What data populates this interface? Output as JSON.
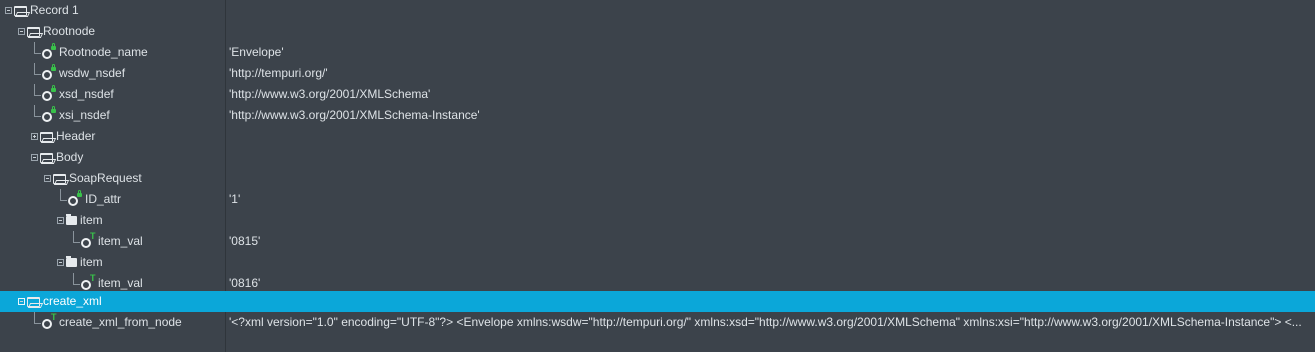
{
  "rows": [
    {
      "label": "Record 1",
      "value": ""
    },
    {
      "label": "Rootnode",
      "value": ""
    },
    {
      "label": "Rootnode_name",
      "value": "'Envelope'"
    },
    {
      "label": "wsdw_nsdef",
      "value": "'http://tempuri.org/'"
    },
    {
      "label": "xsd_nsdef",
      "value": "'http://www.w3.org/2001/XMLSchema'"
    },
    {
      "label": "xsi_nsdef",
      "value": "'http://www.w3.org/2001/XMLSchema-Instance'"
    },
    {
      "label": "Header",
      "value": ""
    },
    {
      "label": "Body",
      "value": ""
    },
    {
      "label": "SoapRequest",
      "value": ""
    },
    {
      "label": "ID_attr",
      "value": "'1'"
    },
    {
      "label": "item",
      "value": ""
    },
    {
      "label": "item_val",
      "value": "'0815'"
    },
    {
      "label": "item",
      "value": ""
    },
    {
      "label": "item_val",
      "value": "'0816'"
    },
    {
      "label": "create_xml",
      "value": ""
    },
    {
      "label": "create_xml_from_node",
      "value": "'<?xml version=\"1.0\" encoding=\"UTF-8\"?> <Envelope xmlns:wsdw=\"http://tempuri.org/\" xmlns:xsd=\"http://www.w3.org/2001/XMLSchema\" xmlns:xsi=\"http://www.w3.org/2001/XMLSchema-Instance\"> <..."
    }
  ],
  "colors": {
    "background": "#3c434b",
    "selection": "#0ba7d9",
    "lock_green": "#39c24a"
  },
  "icons": {
    "record": "folder-open-icon",
    "attribute": "lock-node-icon",
    "element": "text-node-icon",
    "item": "folder-closed-icon"
  }
}
